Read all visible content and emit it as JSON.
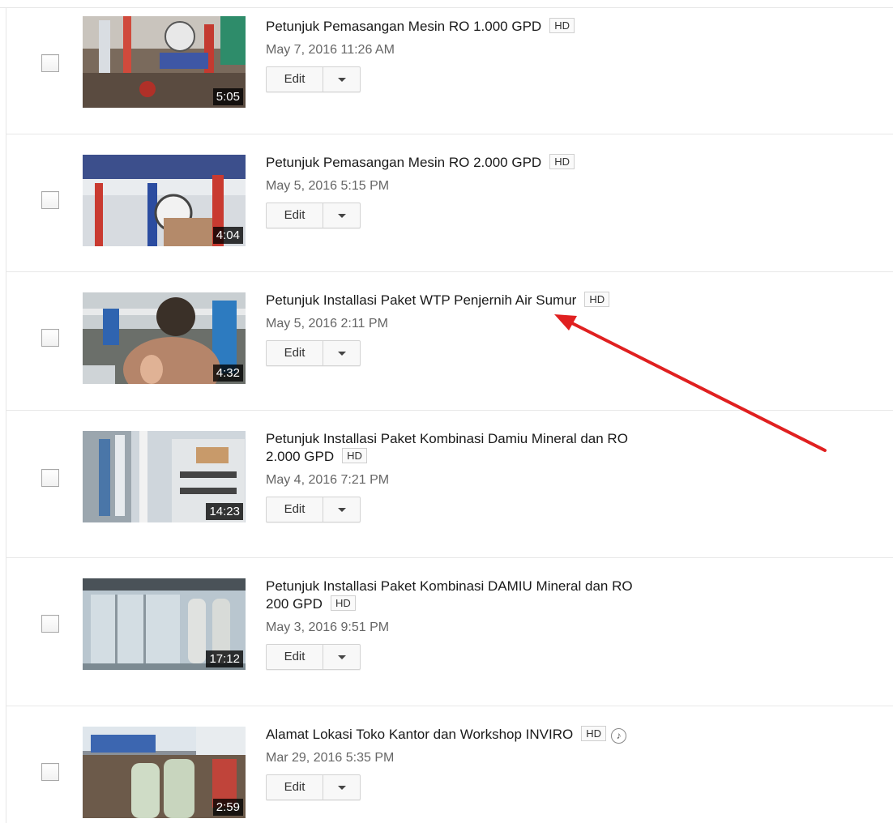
{
  "common": {
    "edit_label": "Edit"
  },
  "videos": [
    {
      "title": "Petunjuk Pemasangan Mesin RO 1.000 GPD",
      "title_line2": "",
      "badge": "HD",
      "has_music": false,
      "date": "May 7, 2016 11:26 AM",
      "duration": "5:05"
    },
    {
      "title": "Petunjuk Pemasangan Mesin RO 2.000 GPD",
      "title_line2": "",
      "badge": "HD",
      "has_music": false,
      "date": "May 5, 2016 5:15 PM",
      "duration": "4:04"
    },
    {
      "title": "Petunjuk Installasi Paket WTP Penjernih Air Sumur",
      "title_line2": "",
      "badge": "HD",
      "has_music": false,
      "date": "May 5, 2016 2:11 PM",
      "duration": "4:32"
    },
    {
      "title": "Petunjuk Installasi Paket Kombinasi Damiu Mineral dan RO",
      "title_line2": "2.000 GPD",
      "badge": "HD",
      "has_music": false,
      "date": "May 4, 2016 7:21 PM",
      "duration": "14:23"
    },
    {
      "title": "Petunjuk Installasi Paket Kombinasi DAMIU Mineral dan RO",
      "title_line2": "200 GPD",
      "badge": "HD",
      "has_music": false,
      "date": "May 3, 2016 9:51 PM",
      "duration": "17:12"
    },
    {
      "title": "Alamat Lokasi Toko Kantor dan Workshop INVIRO",
      "title_line2": "",
      "badge": "HD",
      "has_music": true,
      "date": "Mar 29, 2016 5:35 PM",
      "duration": "2:59"
    }
  ],
  "colors": {
    "annotation_arrow": "#e02020"
  }
}
